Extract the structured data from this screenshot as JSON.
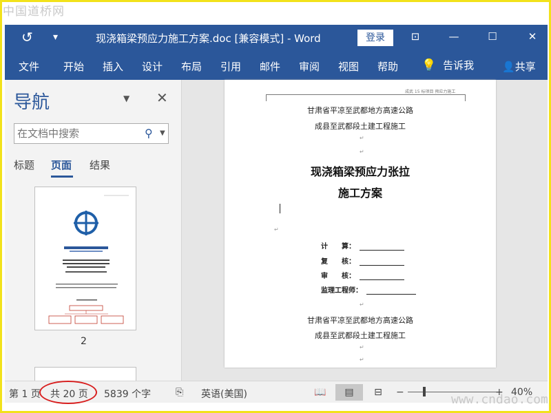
{
  "watermark": {
    "top_text": "中国道桥网",
    "bottom_text": "www.cndao.com"
  },
  "titlebar": {
    "doc_title": "现浇箱梁预应力施工方案.doc [兼容模式] - Word",
    "login_label": "登录",
    "background_color": "#2b579a"
  },
  "ribbon": {
    "tabs": [
      "文件",
      "开始",
      "插入",
      "设计",
      "布局",
      "引用",
      "邮件",
      "审阅",
      "视图",
      "帮助"
    ],
    "tell_me": "告诉我",
    "share": "共享"
  },
  "nav_pane": {
    "title": "导航",
    "search_placeholder": "在文档中搜索",
    "tabs": [
      "标题",
      "页面",
      "结果"
    ],
    "active_tab": "页面",
    "thumbnail_page_number": "2"
  },
  "thumbnail": {
    "logo_text": "中国交通建设",
    "heading_line": "现浇箱梁预应力张拉施工方案",
    "org_chart_top": "项目经理（甲方）"
  },
  "document": {
    "header_text": "成武 15 标项目 预应力施工",
    "lines": [
      "甘肃省平凉至武都地方高速公路",
      "成县至武都段土建工程施工"
    ],
    "title_line1": "现浇箱梁预应力张拉",
    "title_line2": "施工方案",
    "signatures": [
      "计　　算：",
      "复　　核：",
      "审　　核：",
      "监理工程师："
    ],
    "footer_lines": [
      "甘肃省平凉至武都地方高速公路",
      "成县至武都段土建工程施工"
    ],
    "para_mark": "↵"
  },
  "statusbar": {
    "page": "第 1 页",
    "total_pages": "共 20 页",
    "word_count": "5839 个字",
    "language": "英语(美国)",
    "zoom": "40%",
    "zoom_minus": "−",
    "zoom_plus": "+"
  }
}
